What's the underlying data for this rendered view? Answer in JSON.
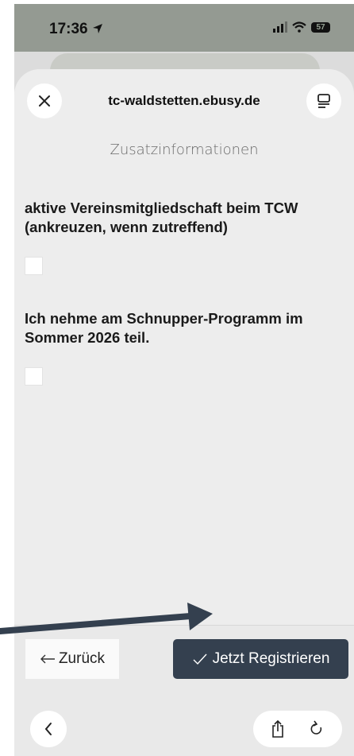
{
  "status_bar": {
    "time": "17:36",
    "battery": "57"
  },
  "header": {
    "domain": "tc-waldstetten.ebusy.de",
    "subtitle": "Zusatzinformationen"
  },
  "questions": [
    {
      "label": "aktive Vereinsmitgliedschaft beim TCW (ankreuzen, wenn zutreffend)",
      "checked": false
    },
    {
      "label": "Ich nehme am Schnupper-Programm im Sommer 2026 teil.",
      "checked": false
    }
  ],
  "actions": {
    "back_label": "Zurück",
    "register_label": "Jetzt Registrieren"
  },
  "colors": {
    "primary_button": "#34404f",
    "sheet_background": "#ededed",
    "annotation_arrow": "#34404f"
  },
  "icons": [
    "location-arrow-icon",
    "signal-icon",
    "wifi-icon",
    "battery-icon",
    "close-icon",
    "reader-mode-icon",
    "arrow-left-icon",
    "check-icon",
    "chevron-left-icon",
    "share-icon",
    "reload-icon"
  ]
}
